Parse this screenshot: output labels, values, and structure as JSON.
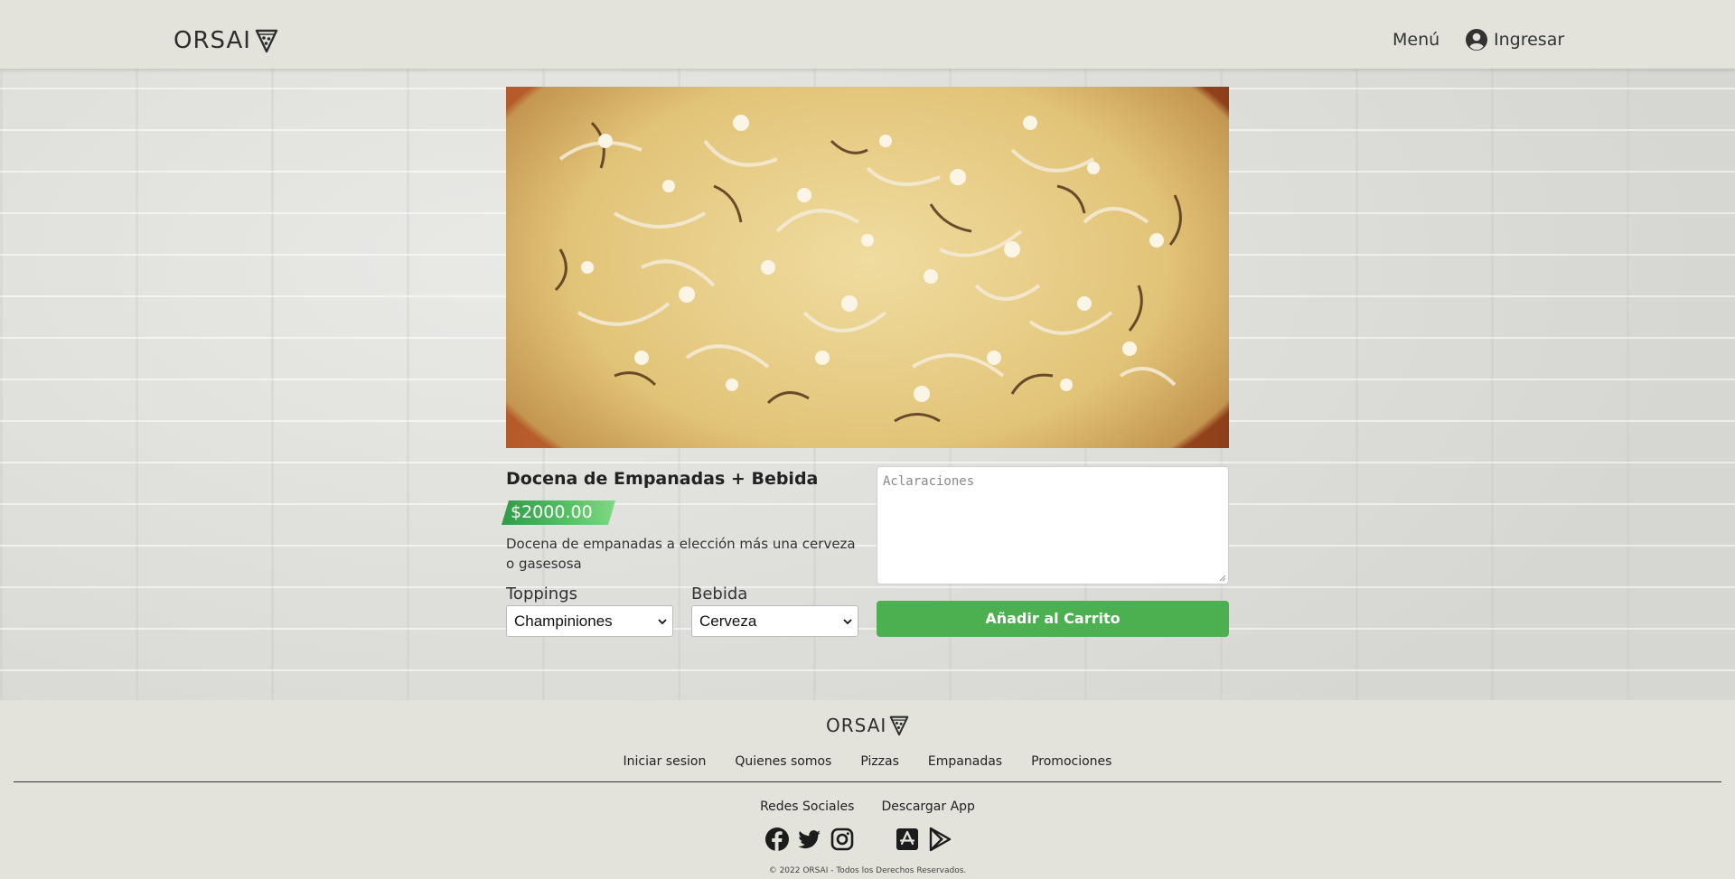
{
  "header": {
    "logo_text": "ORSAI",
    "menu_label": "Menú",
    "login_label": "Ingresar"
  },
  "product": {
    "title": "Docena de Empanadas + Bebida",
    "price": "$2000.00",
    "description": "Docena de empanadas a elección más una cerveza o gasesosa",
    "toppings_label": "Toppings",
    "toppings_selected": "Champiniones",
    "drink_label": "Bebida",
    "drink_selected": "Cerveza",
    "notes_placeholder": "Aclaraciones",
    "add_button": "Añadir al Carrito"
  },
  "footer": {
    "logo_text": "ORSAI",
    "links": [
      "Iniciar sesion",
      "Quienes somos",
      "Pizzas",
      "Empanadas",
      "Promociones"
    ],
    "social_heading": "Redes Sociales",
    "app_heading": "Descargar App",
    "social_icons": [
      "facebook-icon",
      "twitter-icon",
      "instagram-icon"
    ],
    "app_icons": [
      "app-store-icon",
      "google-play-icon"
    ],
    "copyright": "© 2022 ORSAI - Todos los Derechos Reservados."
  },
  "colors": {
    "accent_green": "#4caf50",
    "header_bg": "#e3e3dc"
  }
}
